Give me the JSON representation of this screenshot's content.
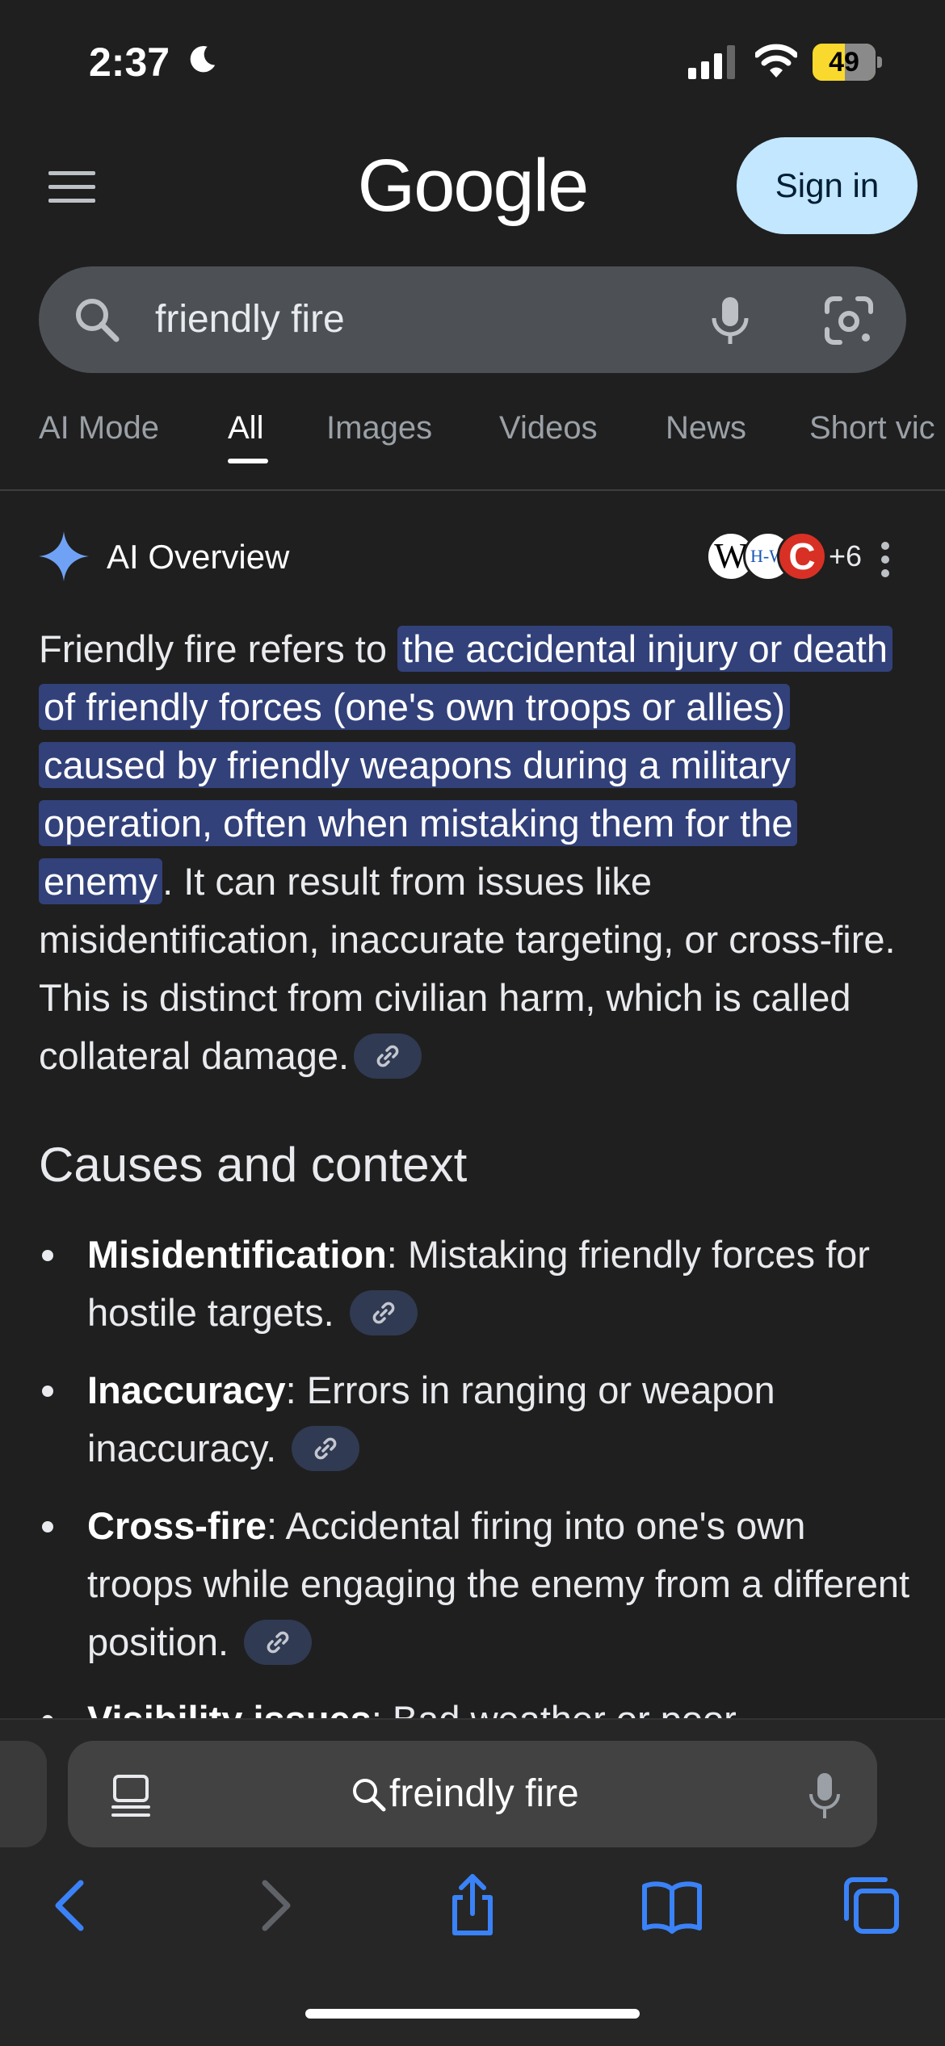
{
  "status_bar": {
    "time": "2:37",
    "battery": "49"
  },
  "header": {
    "logo": "Google",
    "sign_in": "Sign in"
  },
  "search": {
    "query": "friendly fire"
  },
  "tabs": [
    "AI Mode",
    "All",
    "Images",
    "Videos",
    "News",
    "Short vic"
  ],
  "ai_overview": {
    "title": "AI Overview",
    "sources_more": "+6",
    "source_badges": {
      "w": "W",
      "lw": "H-W",
      "c": "C"
    },
    "intro_before": "Friendly fire refers to ",
    "intro_highlight": "the accidental injury or death of friendly forces (one's own troops or allies) caused by friendly weapons during a military operation, often when mistaking them for the enemy",
    "intro_after": ". It can result from issues like misidentification, inaccurate targeting, or cross-fire. This is distinct from civilian harm, which is called collateral damage.",
    "section_title": "Causes and context",
    "bullets": [
      {
        "term": "Misidentification",
        "text": ": Mistaking friendly forces for hostile targets."
      },
      {
        "term": "Inaccuracy",
        "text": ": Errors in ranging or weapon inaccuracy."
      },
      {
        "term": "Cross-fire",
        "text": ": Accidental firing into one's own troops while engaging the enemy from a different position."
      },
      {
        "term": "Visibility issues",
        "text": ": Bad weather or poor"
      }
    ]
  },
  "browser": {
    "address_text": "freindly fire"
  },
  "colors": {
    "background": "#1f1f1f",
    "highlight": "#32417a",
    "sign_in_bg": "#c2e7ff",
    "safari_blue": "#3a82f7"
  }
}
